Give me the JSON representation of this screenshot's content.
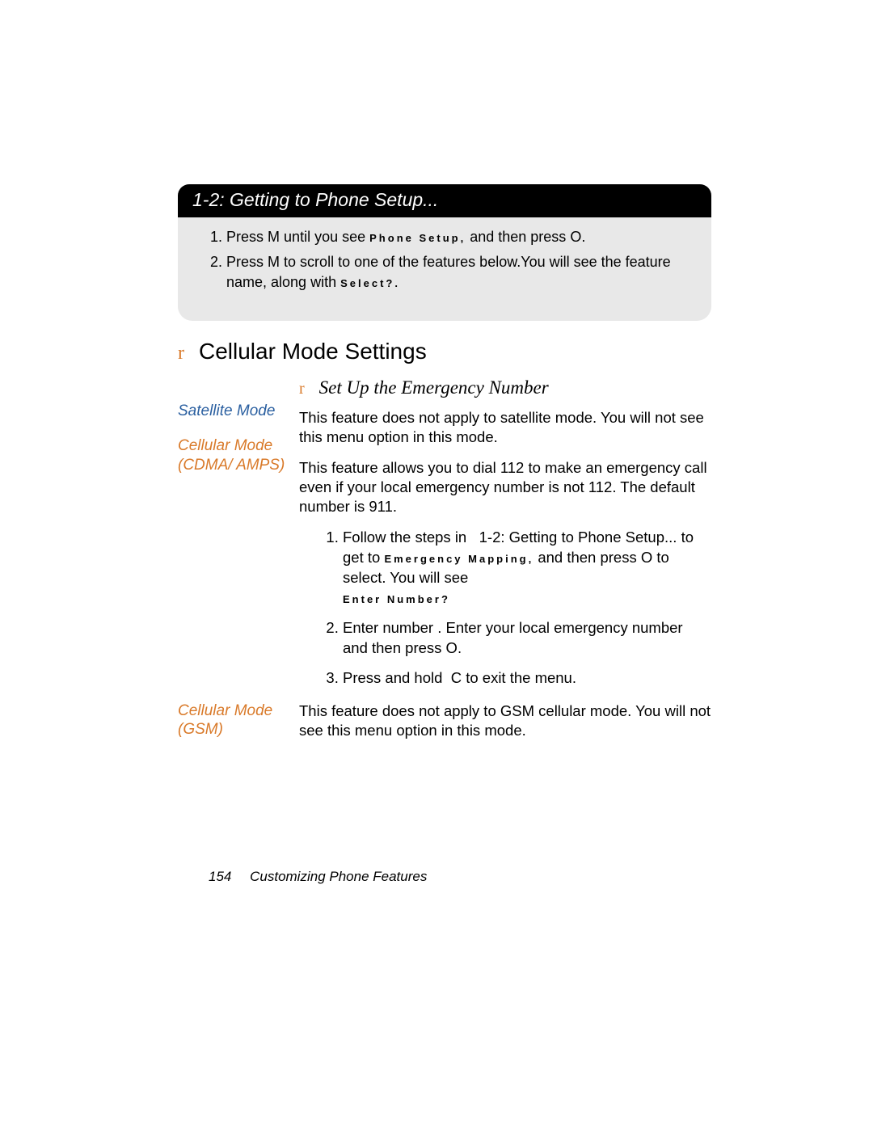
{
  "header": {
    "number": "1-2:",
    "title": "Getting to Phone Setup..."
  },
  "greySteps": {
    "step1_a": "Press",
    "step1_key1": "M",
    "step1_b": "until you see",
    "step1_menu": "Phone Setup,",
    "step1_c": "and then press",
    "step1_key2": "O",
    "step1_d": ".",
    "step2_a": "Press",
    "step2_key": "M",
    "step2_b": "to scroll to one of the features below.You will see the feature name, along with",
    "step2_menu": "Select?."
  },
  "section": {
    "marker": "r",
    "title": "Cellular Mode Settings"
  },
  "sub": {
    "marker": "r",
    "title": "Set Up the Emergency Number"
  },
  "side": {
    "satellite": "Satellite Mode",
    "cdma": "Cellular Mode (CDMA/ AMPS)",
    "gsm": "Cellular Mode (GSM)"
  },
  "satelliteText": "This feature does not apply to satellite mode. You will not see this menu option in this mode.",
  "cdmaIntro": "This feature allows you to dial 112 to make an emergency call even if your local emergency number is not 112. The default number is 911.",
  "cdmaSteps": {
    "s1_a": "Follow the steps in",
    "s1_ref": "1-2: Getting to Phone Setup...",
    "s1_b": "to get to",
    "s1_menu1": "Emergency Mapping,",
    "s1_c": "and then press",
    "s1_key": "O",
    "s1_d": "to select. You will see",
    "s1_menu2": "Enter Number?",
    "s2_a": "Enter number . Enter your local emergency number and then press",
    "s2_key": "O",
    "s2_b": ".",
    "s3_a": "Press and hold",
    "s3_key": "C",
    "s3_b": "to exit the menu."
  },
  "gsmText": "This feature does not apply to GSM cellular mode. You will not see this menu option in this mode.",
  "footer": {
    "page": "154",
    "chapter": "Customizing Phone Features"
  }
}
